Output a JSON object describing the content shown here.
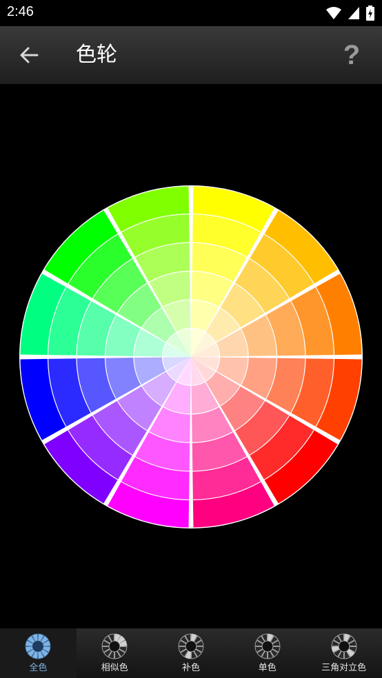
{
  "status": {
    "time": "2:46",
    "icons": [
      "wifi-icon",
      "signal-icon",
      "battery-charging-icon"
    ]
  },
  "header": {
    "title": "色轮",
    "back_icon": "arrow-left-icon",
    "help_label": "?"
  },
  "wheel": {
    "segments": 12,
    "rings": 6,
    "hues": [
      "#ffff00",
      "#ffbf00",
      "#ff8000",
      "#ff4000",
      "#ff0000",
      "#ff0080",
      "#ff00ff",
      "#8000ff",
      "#0000ff",
      "#00ff80",
      "#00ff00",
      "#80ff00"
    ]
  },
  "nav": {
    "active_index": 0,
    "active_color": "#7fb3e6",
    "items": [
      {
        "label": "全色",
        "icon": "full-wheel-icon"
      },
      {
        "label": "相似色",
        "icon": "analogous-wheel-icon"
      },
      {
        "label": "补色",
        "icon": "complementary-wheel-icon"
      },
      {
        "label": "单色",
        "icon": "monochrome-wheel-icon"
      },
      {
        "label": "三角对立色",
        "icon": "triadic-wheel-icon"
      }
    ]
  }
}
